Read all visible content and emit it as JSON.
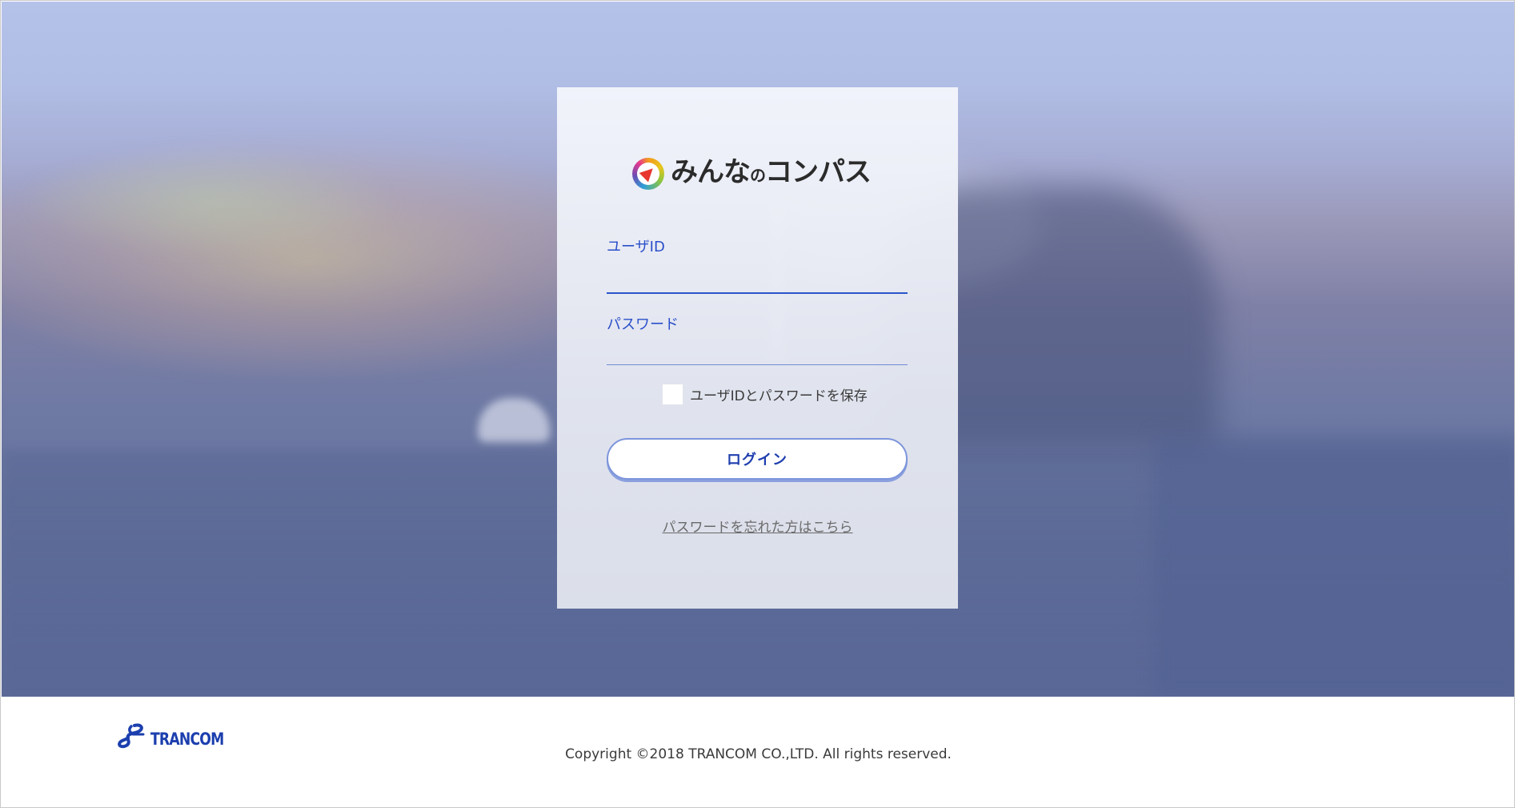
{
  "app": {
    "name": "みんなのコンパス",
    "name_main": "みんなの",
    "name_small": "の",
    "name_tail": "コンパス",
    "logo_icon": "compass-icon"
  },
  "form": {
    "userid_label": "ユーザID",
    "userid_value": "",
    "password_label": "パスワード",
    "password_value": "",
    "save_label": "ユーザIDとパスワードを保存",
    "save_checked": false,
    "login_label": "ログイン",
    "forgot_label": "パスワードを忘れた方はこちら"
  },
  "footer": {
    "brand_name": "TRANCOM",
    "brand_icon": "trancom-logo-icon",
    "copyright": "Copyright ©2018 TRANCOM CO.,LTD. All rights reserved."
  },
  "colors": {
    "accent": "#2a4fc9",
    "button_text": "#1f3fae",
    "brand": "#1c3fae"
  }
}
